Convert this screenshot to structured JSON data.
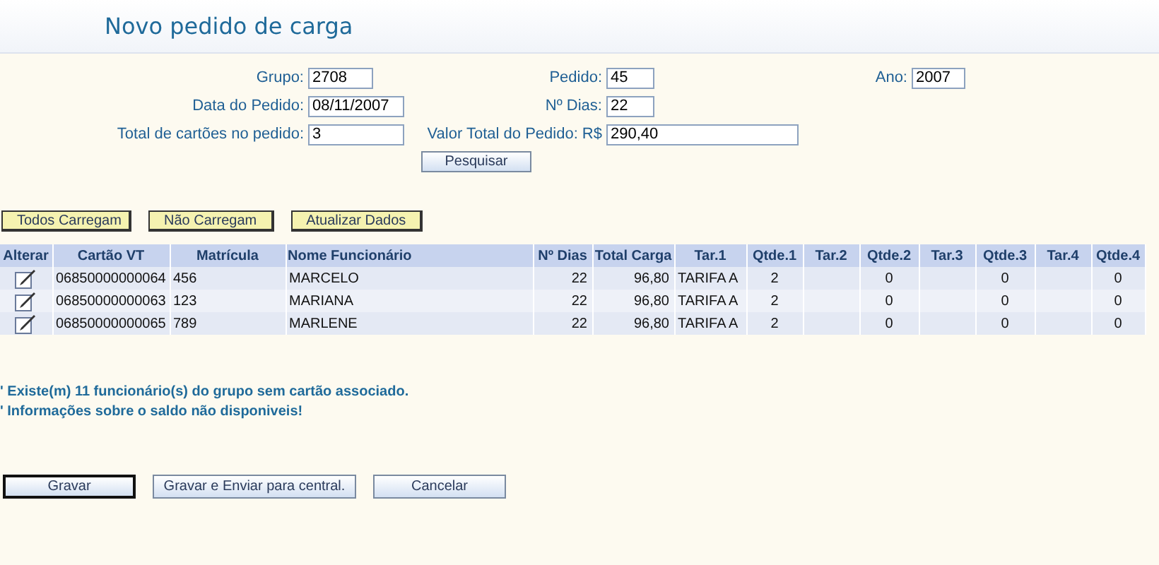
{
  "title": "Novo pedido de carga",
  "form": [
    {
      "label": "Grupo:",
      "value": "2708"
    },
    {
      "label": "Pedido:",
      "value": "45"
    },
    {
      "label": "Ano:",
      "value": "2007"
    },
    {
      "label": "Data do Pedido:",
      "value": "08/11/2007"
    },
    {
      "label": "Nº Dias:",
      "value": "22"
    },
    {
      "label": "Total de cartões no pedido:",
      "value": "3"
    },
    {
      "label": "Valor Total do Pedido: R$",
      "value": "290,40"
    }
  ],
  "search_button": "Pesquisar",
  "action_buttons": [
    "Todos Carregam",
    "Não Carregam",
    "Atualizar Dados"
  ],
  "table": {
    "columns": [
      "Alterar",
      "Cartão VT",
      "Matrícula",
      "Nome Funcionário",
      "Nº Dias",
      "Total Carga",
      "Tar.1",
      "Qtde.1",
      "Tar.2",
      "Qtde.2",
      "Tar.3",
      "Qtde.3",
      "Tar.4",
      "Qtde.4"
    ],
    "rows": [
      {
        "cells": [
          "",
          "06850000000064",
          "456",
          "MARCELO",
          "22",
          "96,80",
          "TARIFA A",
          "2",
          "",
          "0",
          "",
          "0",
          "",
          "0"
        ]
      },
      {
        "cells": [
          "",
          "06850000000063",
          "123",
          "MARIANA",
          "22",
          "96,80",
          "TARIFA A",
          "2",
          "",
          "0",
          "",
          "0",
          "",
          "0"
        ]
      },
      {
        "cells": [
          "",
          "06850000000065",
          "789",
          "MARLENE",
          "22",
          "96,80",
          "TARIFA A",
          "2",
          "",
          "0",
          "",
          "0",
          "",
          "0"
        ]
      }
    ]
  },
  "notes": [
    "' Existe(m) 11 funcionário(s) do grupo sem cartão associado.",
    "' Informações sobre o saldo não disponiveis!"
  ],
  "footer_buttons": [
    {
      "label": "Gravar",
      "focused": true
    },
    {
      "label": "Gravar e Enviar para central.",
      "focused": false
    },
    {
      "label": "Cancelar",
      "focused": false
    }
  ]
}
